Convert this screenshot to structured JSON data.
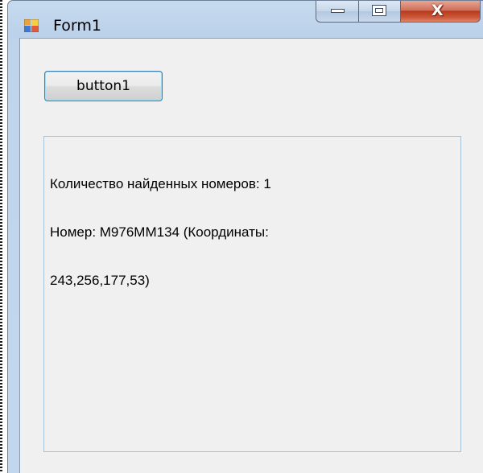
{
  "window": {
    "title": "Form1",
    "close_symbol": "X"
  },
  "icons": {
    "app": "winforms-form-icon",
    "minimize": "minimize-icon",
    "maximize": "maximize-icon",
    "close": "close-icon"
  },
  "form": {
    "button1_label": "button1",
    "output_lines": [
      "Количество найденных номеров: 1",
      "Номер: М976ММ134 (Координаты:",
      "243,256,177,53)"
    ]
  },
  "colors": {
    "close_button": "#c74a2b",
    "button_border": "#3c7fb1",
    "client_background": "#f0f0f0"
  }
}
